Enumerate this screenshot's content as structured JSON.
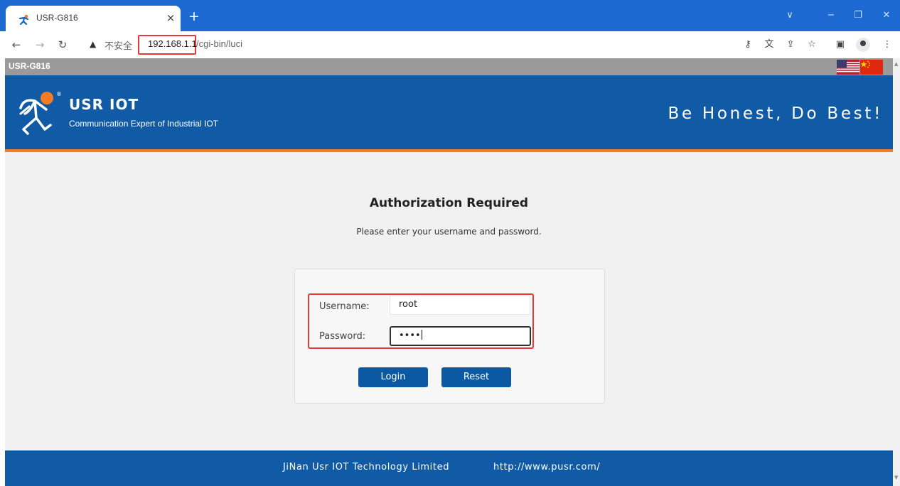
{
  "browser": {
    "tab_title": "USR-G816",
    "tab_close": "×",
    "new_tab": "+",
    "insecure_label": "不安全",
    "url_host": "192.168.1.1",
    "url_path": "/cgi-bin/luci"
  },
  "page": {
    "device_name": "USR-G816",
    "brand": {
      "title": "USR IOT",
      "subtitle": "Communication Expert of Industrial IOT",
      "slogan": "Be Honest, Do Best!"
    },
    "auth": {
      "title": "Authorization Required",
      "description": "Please enter your username and password.",
      "username_label": "Username:",
      "username_value": "root",
      "password_label": "Password:",
      "password_value": "••••",
      "login_label": "Login",
      "reset_label": "Reset"
    },
    "footer": {
      "company": "JiNan Usr IOT Technology Limited",
      "url": "http://www.pusr.com/"
    }
  },
  "colors": {
    "browser_blue": "#1c6ad1",
    "header_blue": "#115aa6",
    "accent_orange": "#f47b20",
    "highlight_red": "#e53935",
    "button_blue": "#0b59a3"
  },
  "icons": [
    "usr-favicon-icon",
    "back-icon",
    "forward-icon",
    "reload-icon",
    "warning-icon",
    "key-icon",
    "translate-icon",
    "share-icon",
    "star-icon",
    "sidepanel-icon",
    "profile-icon",
    "menu-icon",
    "us-flag-icon",
    "cn-flag-icon",
    "usr-logo-icon"
  ]
}
